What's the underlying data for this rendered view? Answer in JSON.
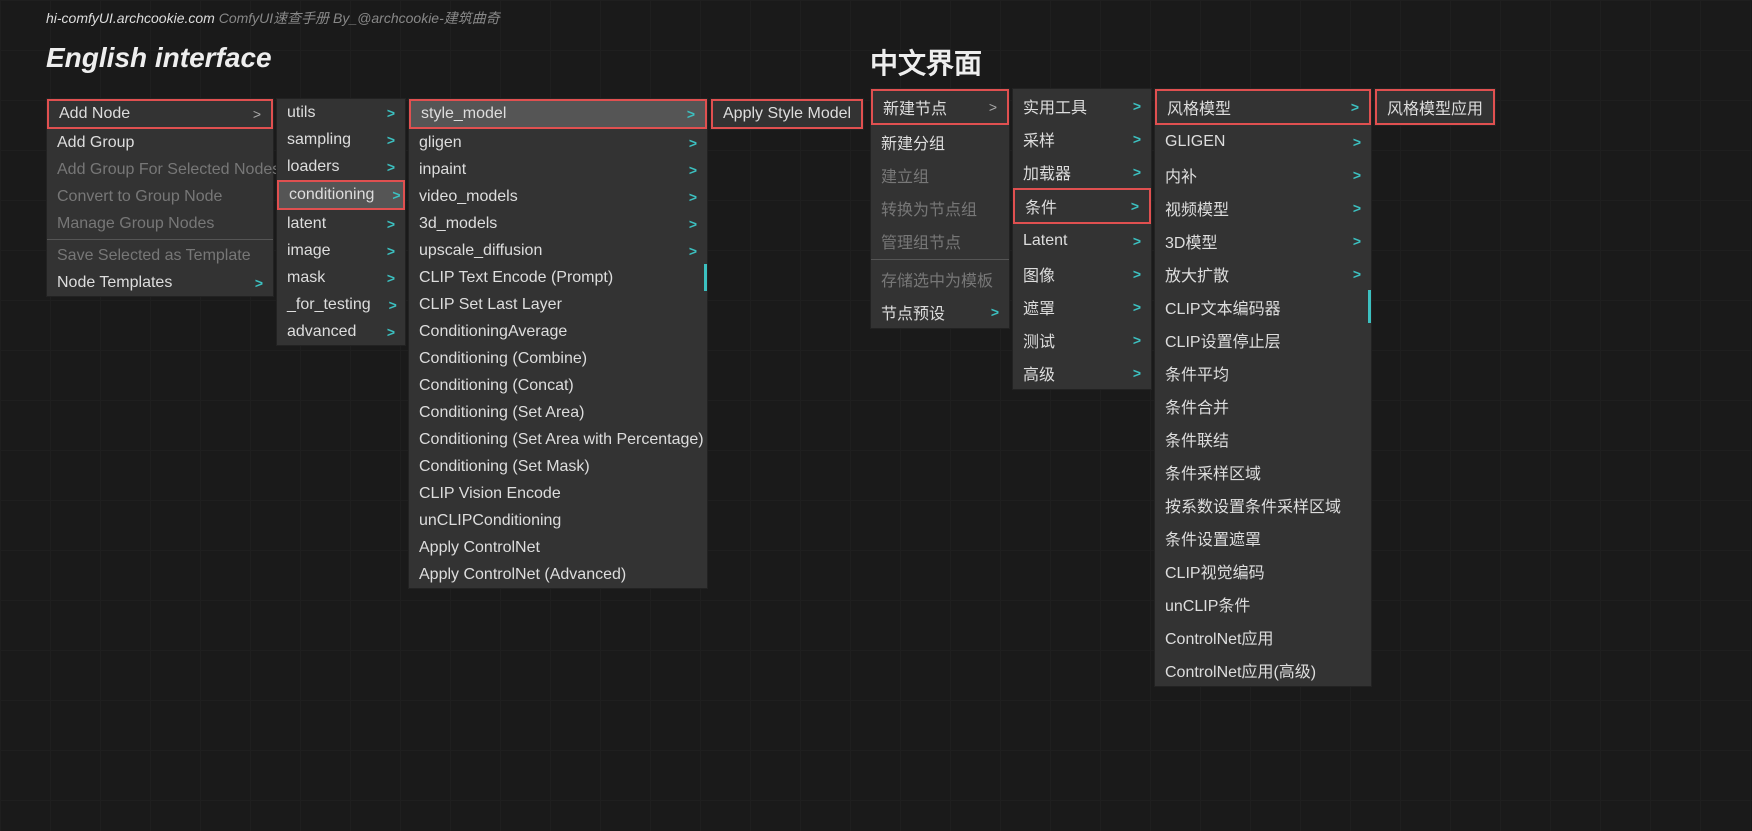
{
  "header": {
    "url": "hi-comfyUI.archcookie.com",
    "sub": "ComfyUI速查手册 By_@archcookie-建筑曲奇"
  },
  "titles": {
    "left": "English interface",
    "right": "中文界面"
  },
  "menus": {
    "en1": [
      {
        "label": "Add Node",
        "arrow": true,
        "hl": true
      },
      {
        "label": "Add Group"
      },
      {
        "label": "Add Group For Selected Nodes",
        "disabled": true
      },
      {
        "label": "Convert to Group Node",
        "disabled": true
      },
      {
        "label": "Manage Group Nodes",
        "disabled": true
      },
      {
        "sep": true
      },
      {
        "label": "Save Selected as Template",
        "disabled": true
      },
      {
        "label": "Node Templates",
        "arrow": true,
        "accent": true
      }
    ],
    "en2": [
      {
        "label": "utils",
        "arrow": true,
        "accent": true
      },
      {
        "label": "sampling",
        "arrow": true,
        "accent": true
      },
      {
        "label": "loaders",
        "arrow": true,
        "accent": true
      },
      {
        "label": "conditioning",
        "arrow": true,
        "accent": true,
        "hl": true,
        "hover": true
      },
      {
        "label": "latent",
        "arrow": true,
        "accent": true
      },
      {
        "label": "image",
        "arrow": true,
        "accent": true
      },
      {
        "label": "mask",
        "arrow": true,
        "accent": true
      },
      {
        "label": "_for_testing",
        "arrow": true,
        "accent": true
      },
      {
        "label": "advanced",
        "arrow": true,
        "accent": true
      }
    ],
    "en3": [
      {
        "label": "style_model",
        "arrow": true,
        "accent": true,
        "hl": true,
        "hover": true
      },
      {
        "label": "gligen",
        "arrow": true,
        "accent": true
      },
      {
        "label": "inpaint",
        "arrow": true,
        "accent": true
      },
      {
        "label": "video_models",
        "arrow": true,
        "accent": true
      },
      {
        "label": "3d_models",
        "arrow": true,
        "accent": true
      },
      {
        "label": "upscale_diffusion",
        "arrow": true,
        "accent": true
      },
      {
        "label": "CLIP Text Encode (Prompt)",
        "side": true
      },
      {
        "label": "CLIP Set Last Layer"
      },
      {
        "label": "ConditioningAverage"
      },
      {
        "label": "Conditioning (Combine)"
      },
      {
        "label": "Conditioning (Concat)"
      },
      {
        "label": "Conditioning (Set Area)"
      },
      {
        "label": "Conditioning (Set Area with Percentage)"
      },
      {
        "label": "Conditioning (Set Mask)"
      },
      {
        "label": "CLIP Vision Encode"
      },
      {
        "label": "unCLIPConditioning"
      },
      {
        "label": "Apply ControlNet"
      },
      {
        "label": "Apply ControlNet (Advanced)"
      }
    ],
    "en4": [
      {
        "label": "Apply Style Model",
        "hl": true
      }
    ],
    "zh1": [
      {
        "label": "新建节点",
        "arrow": true,
        "hl": true
      },
      {
        "label": "新建分组"
      },
      {
        "label": "建立组",
        "disabled": true
      },
      {
        "label": "转换为节点组",
        "disabled": true
      },
      {
        "label": "管理组节点",
        "disabled": true
      },
      {
        "sep": true
      },
      {
        "label": "存储选中为模板",
        "disabled": true
      },
      {
        "label": "节点预设",
        "arrow": true,
        "accent": true
      }
    ],
    "zh2": [
      {
        "label": "实用工具",
        "arrow": true,
        "accent": true
      },
      {
        "label": "采样",
        "arrow": true,
        "accent": true
      },
      {
        "label": "加载器",
        "arrow": true,
        "accent": true
      },
      {
        "label": "条件",
        "arrow": true,
        "accent": true,
        "hl": true
      },
      {
        "label": "Latent",
        "arrow": true,
        "accent": true
      },
      {
        "label": "图像",
        "arrow": true,
        "accent": true
      },
      {
        "label": "遮罩",
        "arrow": true,
        "accent": true
      },
      {
        "label": "测试",
        "arrow": true,
        "accent": true
      },
      {
        "label": "高级",
        "arrow": true,
        "accent": true
      }
    ],
    "zh3": [
      {
        "label": "风格模型",
        "arrow": true,
        "accent": true,
        "hl": true
      },
      {
        "label": "GLIGEN",
        "arrow": true,
        "accent": true
      },
      {
        "label": "内补",
        "arrow": true,
        "accent": true
      },
      {
        "label": "视频模型",
        "arrow": true,
        "accent": true
      },
      {
        "label": "3D模型",
        "arrow": true,
        "accent": true
      },
      {
        "label": "放大扩散",
        "arrow": true,
        "accent": true
      },
      {
        "label": "CLIP文本编码器",
        "side": true
      },
      {
        "label": "CLIP设置停止层"
      },
      {
        "label": "条件平均"
      },
      {
        "label": "条件合并"
      },
      {
        "label": "条件联结"
      },
      {
        "label": "条件采样区域"
      },
      {
        "label": "按系数设置条件采样区域"
      },
      {
        "label": "条件设置遮罩"
      },
      {
        "label": "CLIP视觉编码"
      },
      {
        "label": "unCLIP条件"
      },
      {
        "label": "ControlNet应用"
      },
      {
        "label": "ControlNet应用(高级)"
      }
    ],
    "zh4": [
      {
        "label": "风格模型应用",
        "hl": true
      }
    ]
  }
}
